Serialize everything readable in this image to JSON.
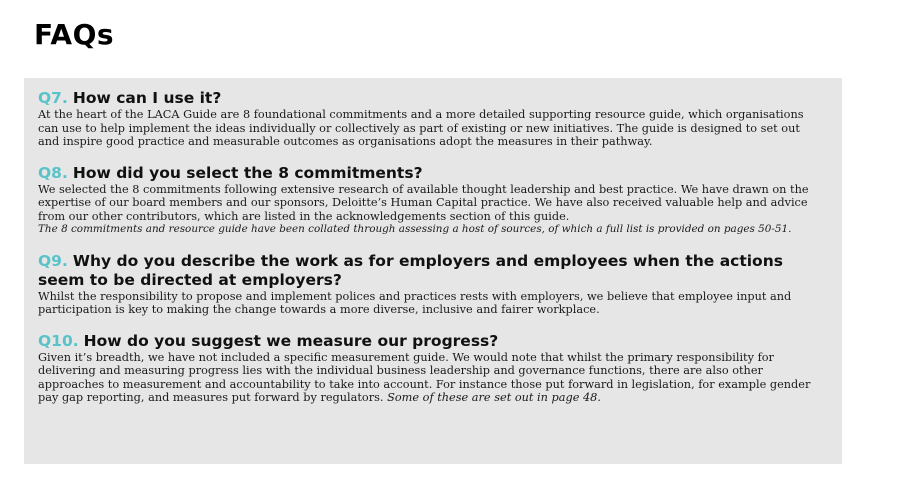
{
  "page_title": "FAQs",
  "accent_color": "#5ac3c8",
  "faqs": [
    {
      "number": "Q7.",
      "question": "How can I use it?",
      "answer": "At the heart of the LACA Guide are 8 foundational commitments and a more detailed supporting resource guide, which organisations can use to help implement the ideas individually or collectively as part of existing or new initiatives. The guide is designed to set out and inspire good practice and measurable outcomes as organisations adopt the measures in their pathway."
    },
    {
      "number": "Q8.",
      "question": "How did you select the 8 commitments?",
      "answer": "We selected the 8 commitments following extensive research of available thought leadership and best practice. We have drawn on the expertise of our board members and our sponsors, Deloitte’s Human Capital practice. We have also received valuable help and advice from our other contributors, which are listed in the acknowledgements section of this guide.",
      "note": "The 8 commitments and resource guide have been collated through assessing a host of sources, of which a full list is provided on pages 50-51."
    },
    {
      "number": "Q9.",
      "question": "Why do you describe the work as for employers and employees when the actions seem to be directed at employers?",
      "answer": "Whilst the responsibility to propose and implement polices and practices rests with employers, we believe that employee input and participation is key to making the change towards a more diverse, inclusive and fairer workplace."
    },
    {
      "number": "Q10.",
      "question": "How do you suggest we measure our progress?",
      "answer": "Given it’s breadth, we have not included a specific measurement guide. We would note that whilst the primary responsibility for delivering and measuring progress lies with the individual business leadership and governance functions, there are also other approaches to measurement and accountability to take into account. For instance those put forward in legislation, for example gender pay gap reporting, and measures put forward by regulators.",
      "answer_italic": "Some of these are set out in page 48."
    }
  ]
}
